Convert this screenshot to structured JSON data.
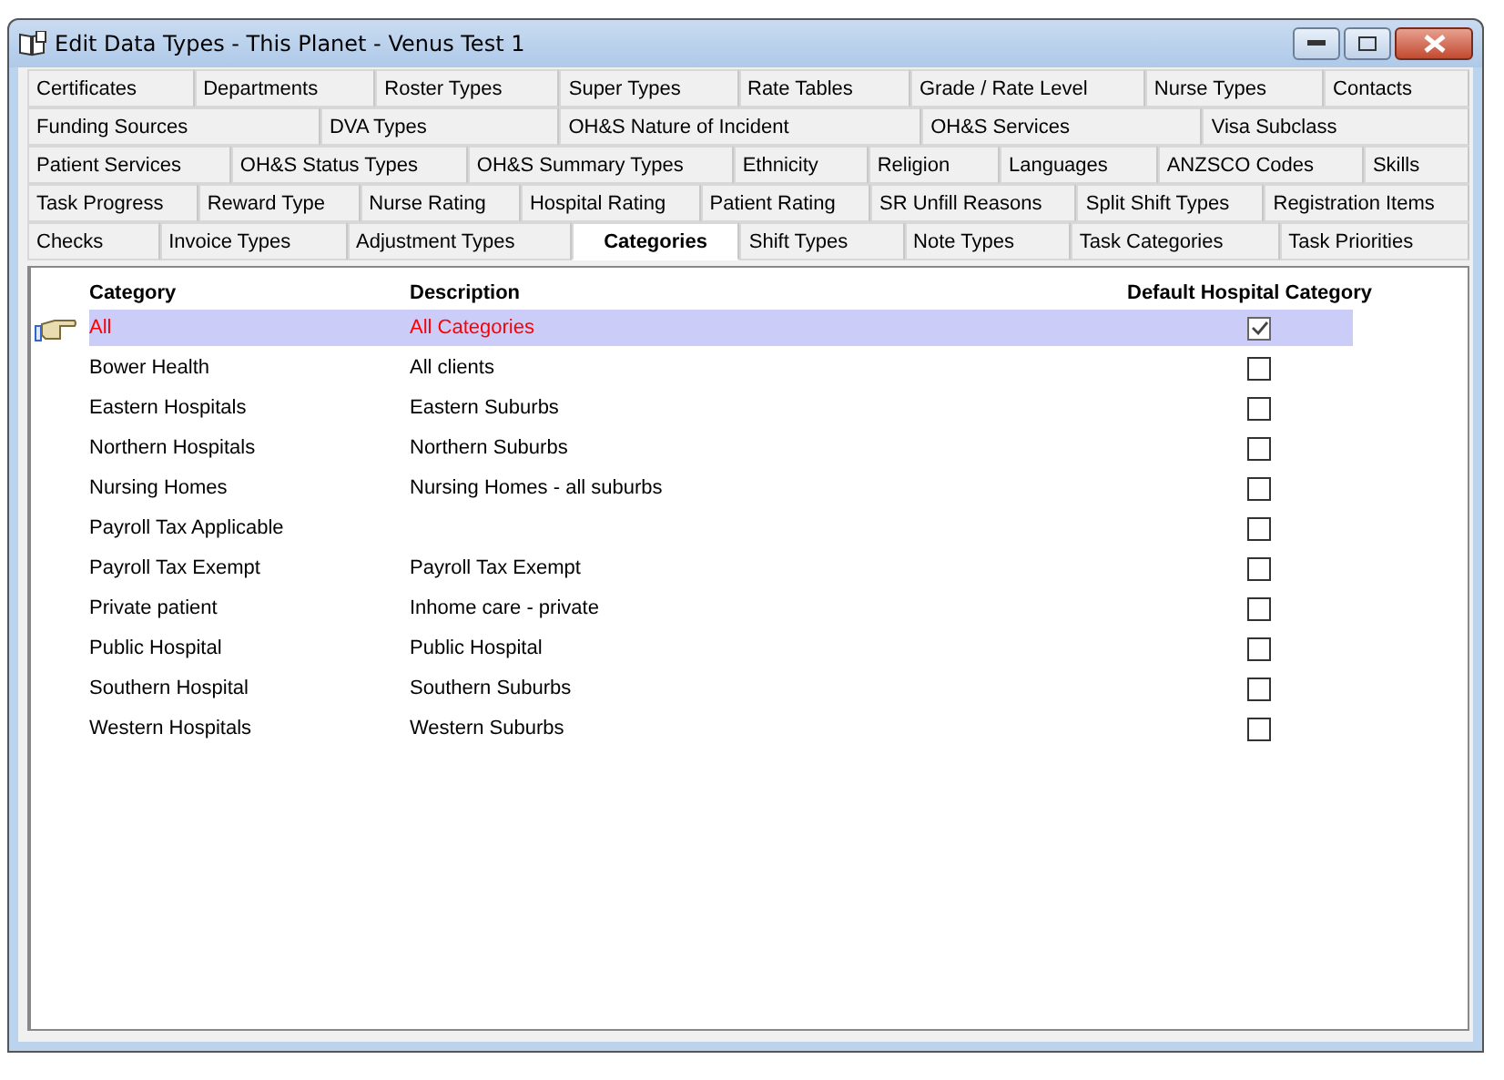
{
  "window": {
    "title": "Edit Data Types  -  This Planet - Venus Test 1"
  },
  "tab_rows": [
    {
      "tabs": [
        {
          "label": "Certificates",
          "selected": false
        },
        {
          "label": "Departments",
          "selected": false
        },
        {
          "label": "Roster Types",
          "selected": false
        },
        {
          "label": "Super Types",
          "selected": false
        },
        {
          "label": "Rate Tables",
          "selected": false
        },
        {
          "label": "Grade / Rate Level",
          "selected": false
        },
        {
          "label": "Nurse Types",
          "selected": false
        },
        {
          "label": "Contacts",
          "selected": false
        }
      ]
    },
    {
      "tabs": [
        {
          "label": "Funding Sources",
          "selected": false
        },
        {
          "label": "DVA Types",
          "selected": false
        },
        {
          "label": "OH&S Nature of Incident",
          "selected": false
        },
        {
          "label": "OH&S Services",
          "selected": false
        },
        {
          "label": "Visa Subclass",
          "selected": false
        }
      ]
    },
    {
      "tabs": [
        {
          "label": "Patient Services",
          "selected": false
        },
        {
          "label": "OH&S Status Types",
          "selected": false
        },
        {
          "label": "OH&S Summary Types",
          "selected": false
        },
        {
          "label": "Ethnicity",
          "selected": false
        },
        {
          "label": "Religion",
          "selected": false
        },
        {
          "label": "Languages",
          "selected": false
        },
        {
          "label": "ANZSCO Codes",
          "selected": false
        },
        {
          "label": "Skills",
          "selected": false
        }
      ]
    },
    {
      "tabs": [
        {
          "label": "Task Progress",
          "selected": false
        },
        {
          "label": "Reward Type",
          "selected": false
        },
        {
          "label": "Nurse Rating",
          "selected": false
        },
        {
          "label": "Hospital Rating",
          "selected": false
        },
        {
          "label": "Patient Rating",
          "selected": false
        },
        {
          "label": "SR Unfill Reasons",
          "selected": false
        },
        {
          "label": "Split Shift Types",
          "selected": false
        },
        {
          "label": "Registration Items",
          "selected": false
        }
      ]
    },
    {
      "tabs": [
        {
          "label": "Checks",
          "selected": false
        },
        {
          "label": "Invoice Types",
          "selected": false
        },
        {
          "label": "Adjustment Types",
          "selected": false
        },
        {
          "label": "Categories",
          "selected": true
        },
        {
          "label": "Shift Types",
          "selected": false
        },
        {
          "label": "Note Types",
          "selected": false
        },
        {
          "label": "Task Categories",
          "selected": false
        },
        {
          "label": "Task Priorities",
          "selected": false
        }
      ]
    }
  ],
  "table": {
    "columns": [
      "Category",
      "Description",
      "Default Hospital Category"
    ],
    "rows": [
      {
        "category": "All",
        "description": "All Categories",
        "checked": true,
        "selected": true
      },
      {
        "category": "Bower Health",
        "description": "All clients",
        "checked": false,
        "selected": false
      },
      {
        "category": "Eastern Hospitals",
        "description": "Eastern Suburbs",
        "checked": false,
        "selected": false
      },
      {
        "category": "Northern Hospitals",
        "description": "Northern Suburbs",
        "checked": false,
        "selected": false
      },
      {
        "category": "Nursing Homes",
        "description": "Nursing Homes - all suburbs",
        "checked": false,
        "selected": false
      },
      {
        "category": "Payroll Tax Applicable",
        "checked": false,
        "selected": false
      },
      {
        "category": "Payroll Tax Exempt",
        "description": "Payroll Tax Exempt",
        "checked": false,
        "selected": false
      },
      {
        "category": "Private patient",
        "description": "Inhome care - private",
        "checked": false,
        "selected": false
      },
      {
        "category": "Public Hospital",
        "description": "Public Hospital",
        "checked": false,
        "selected": false
      },
      {
        "category": "Southern Hospital",
        "description": "Southern Suburbs",
        "checked": false,
        "selected": false
      },
      {
        "category": "Western Hospitals",
        "description": "Western Suburbs",
        "checked": false,
        "selected": false
      }
    ]
  }
}
